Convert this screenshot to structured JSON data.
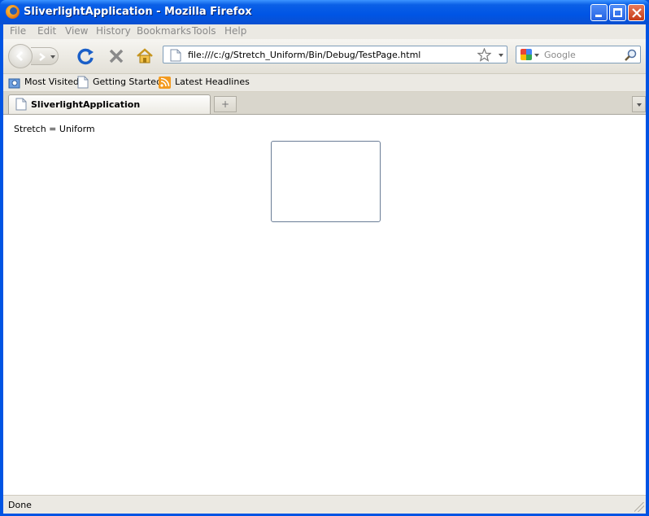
{
  "window": {
    "title": "SliverlightApplication - Mozilla Firefox"
  },
  "menu": [
    {
      "label": "File"
    },
    {
      "label": "Edit"
    },
    {
      "label": "View"
    },
    {
      "label": "History"
    },
    {
      "label": "Bookmarks"
    },
    {
      "label": "Tools"
    },
    {
      "label": "Help"
    }
  ],
  "nav": {
    "url": "file:///c:/g/Stretch_Uniform/Bin/Debug/TestPage.html",
    "search_placeholder": "Google"
  },
  "bookmarks": [
    {
      "label": "Most Visited",
      "icon": "magnifier-folder-icon"
    },
    {
      "label": "Getting Started",
      "icon": "page-icon"
    },
    {
      "label": "Latest Headlines",
      "icon": "rss-feed-icon"
    }
  ],
  "tabs": [
    {
      "label": "SliverlightApplication"
    }
  ],
  "newtab_glyph": "+",
  "content": {
    "text": "Stretch = Uniform"
  },
  "status": {
    "text": "Done"
  },
  "colors": {
    "titlebar": "#0055e5",
    "close": "#c63b16",
    "reload": "#1a5fc8",
    "stop": "#8a8a8a"
  }
}
